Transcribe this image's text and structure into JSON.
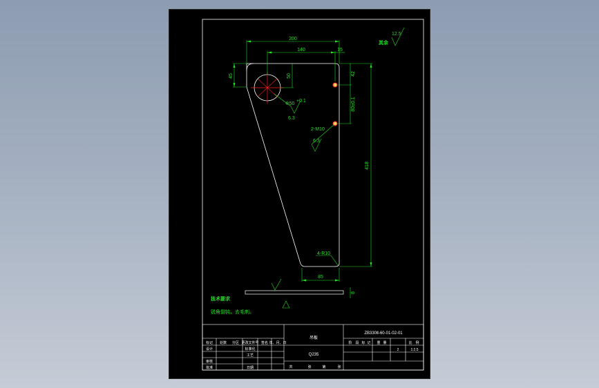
{
  "colors": {
    "part_outline": "#ffffff",
    "dimension": "#22e022",
    "center_mark": "#ff2020",
    "hole_fill": "#ffcc66",
    "frame": "#ffffff"
  },
  "dimensions": {
    "d200": "200",
    "d140": "140",
    "d15": "15",
    "d45": "45",
    "d50": "50",
    "d42": "42",
    "d80": "80±0.1",
    "d418": "418",
    "d85": "85",
    "d8": "8",
    "hole_dia": "Φ50",
    "hole_tol": "+0.1",
    "thread": "2-M10",
    "fillet": "4-R10",
    "rough_hole": "6.3",
    "rough_thread": "6.3",
    "rough_other": "12.5",
    "rough_other_label": "其余"
  },
  "tech": {
    "heading": "技术要求",
    "note": "锐角倒钝，去毛刺。"
  },
  "title_block": {
    "part_name": "吊板",
    "drawing_no": "ZB330Ⅱ-60-01-02-01",
    "material": "Q235",
    "header_cells": [
      "标记",
      "处数",
      "分区",
      "更改文件号",
      "签名",
      "年、月、日"
    ],
    "stage_cells": [
      "阶",
      "段",
      "标",
      "记",
      "重",
      "量",
      "比",
      "例"
    ],
    "left_rows": [
      "设计",
      "",
      "审核",
      "工艺",
      "批准"
    ],
    "standardize": "标准化",
    "approve_date": "日期",
    "quantity": "2",
    "scale": "1:2.5",
    "bottom_cells": [
      "共",
      "张",
      "第",
      "张"
    ]
  }
}
